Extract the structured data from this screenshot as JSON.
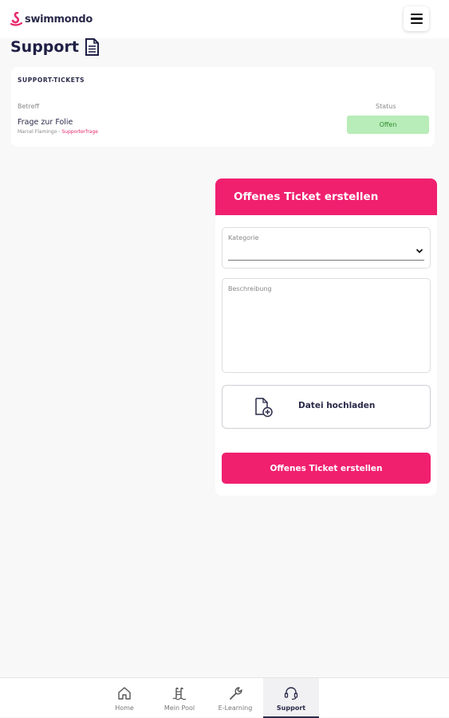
{
  "header": {
    "logo_text": "swimmondo",
    "menu_icon": "hamburger-menu-icon"
  },
  "page": {
    "title": "Support",
    "title_icon": "document-icon"
  },
  "tickets": {
    "heading": "SUPPORT-TICKETS",
    "columns": {
      "subject": "Betreff",
      "status": "Status"
    },
    "rows": [
      {
        "subject": "Frage zur Folie",
        "author": "Marcel Flamingo",
        "separator": " - ",
        "category": "Supporterfrage",
        "status": "Offen"
      }
    ]
  },
  "form": {
    "title": "Offenes Ticket erstellen",
    "category_label": "Kategorie",
    "category_value": "",
    "description_label": "Beschreibung",
    "upload_label": "Datei hochladen",
    "submit_label": "Offenes Ticket erstellen"
  },
  "bottom_nav": {
    "items": [
      {
        "label": "Home",
        "icon": "home-icon"
      },
      {
        "label": "Mein Pool",
        "icon": "pool-ladder-icon"
      },
      {
        "label": "E-Learning",
        "icon": "wrench-icon"
      },
      {
        "label": "Support",
        "icon": "headset-icon",
        "active": true
      }
    ]
  },
  "colors": {
    "brand": "#f0206f",
    "status_bg": "#b8ecb8",
    "status_text": "#2f8a2f",
    "text": "#2a2a4a"
  }
}
